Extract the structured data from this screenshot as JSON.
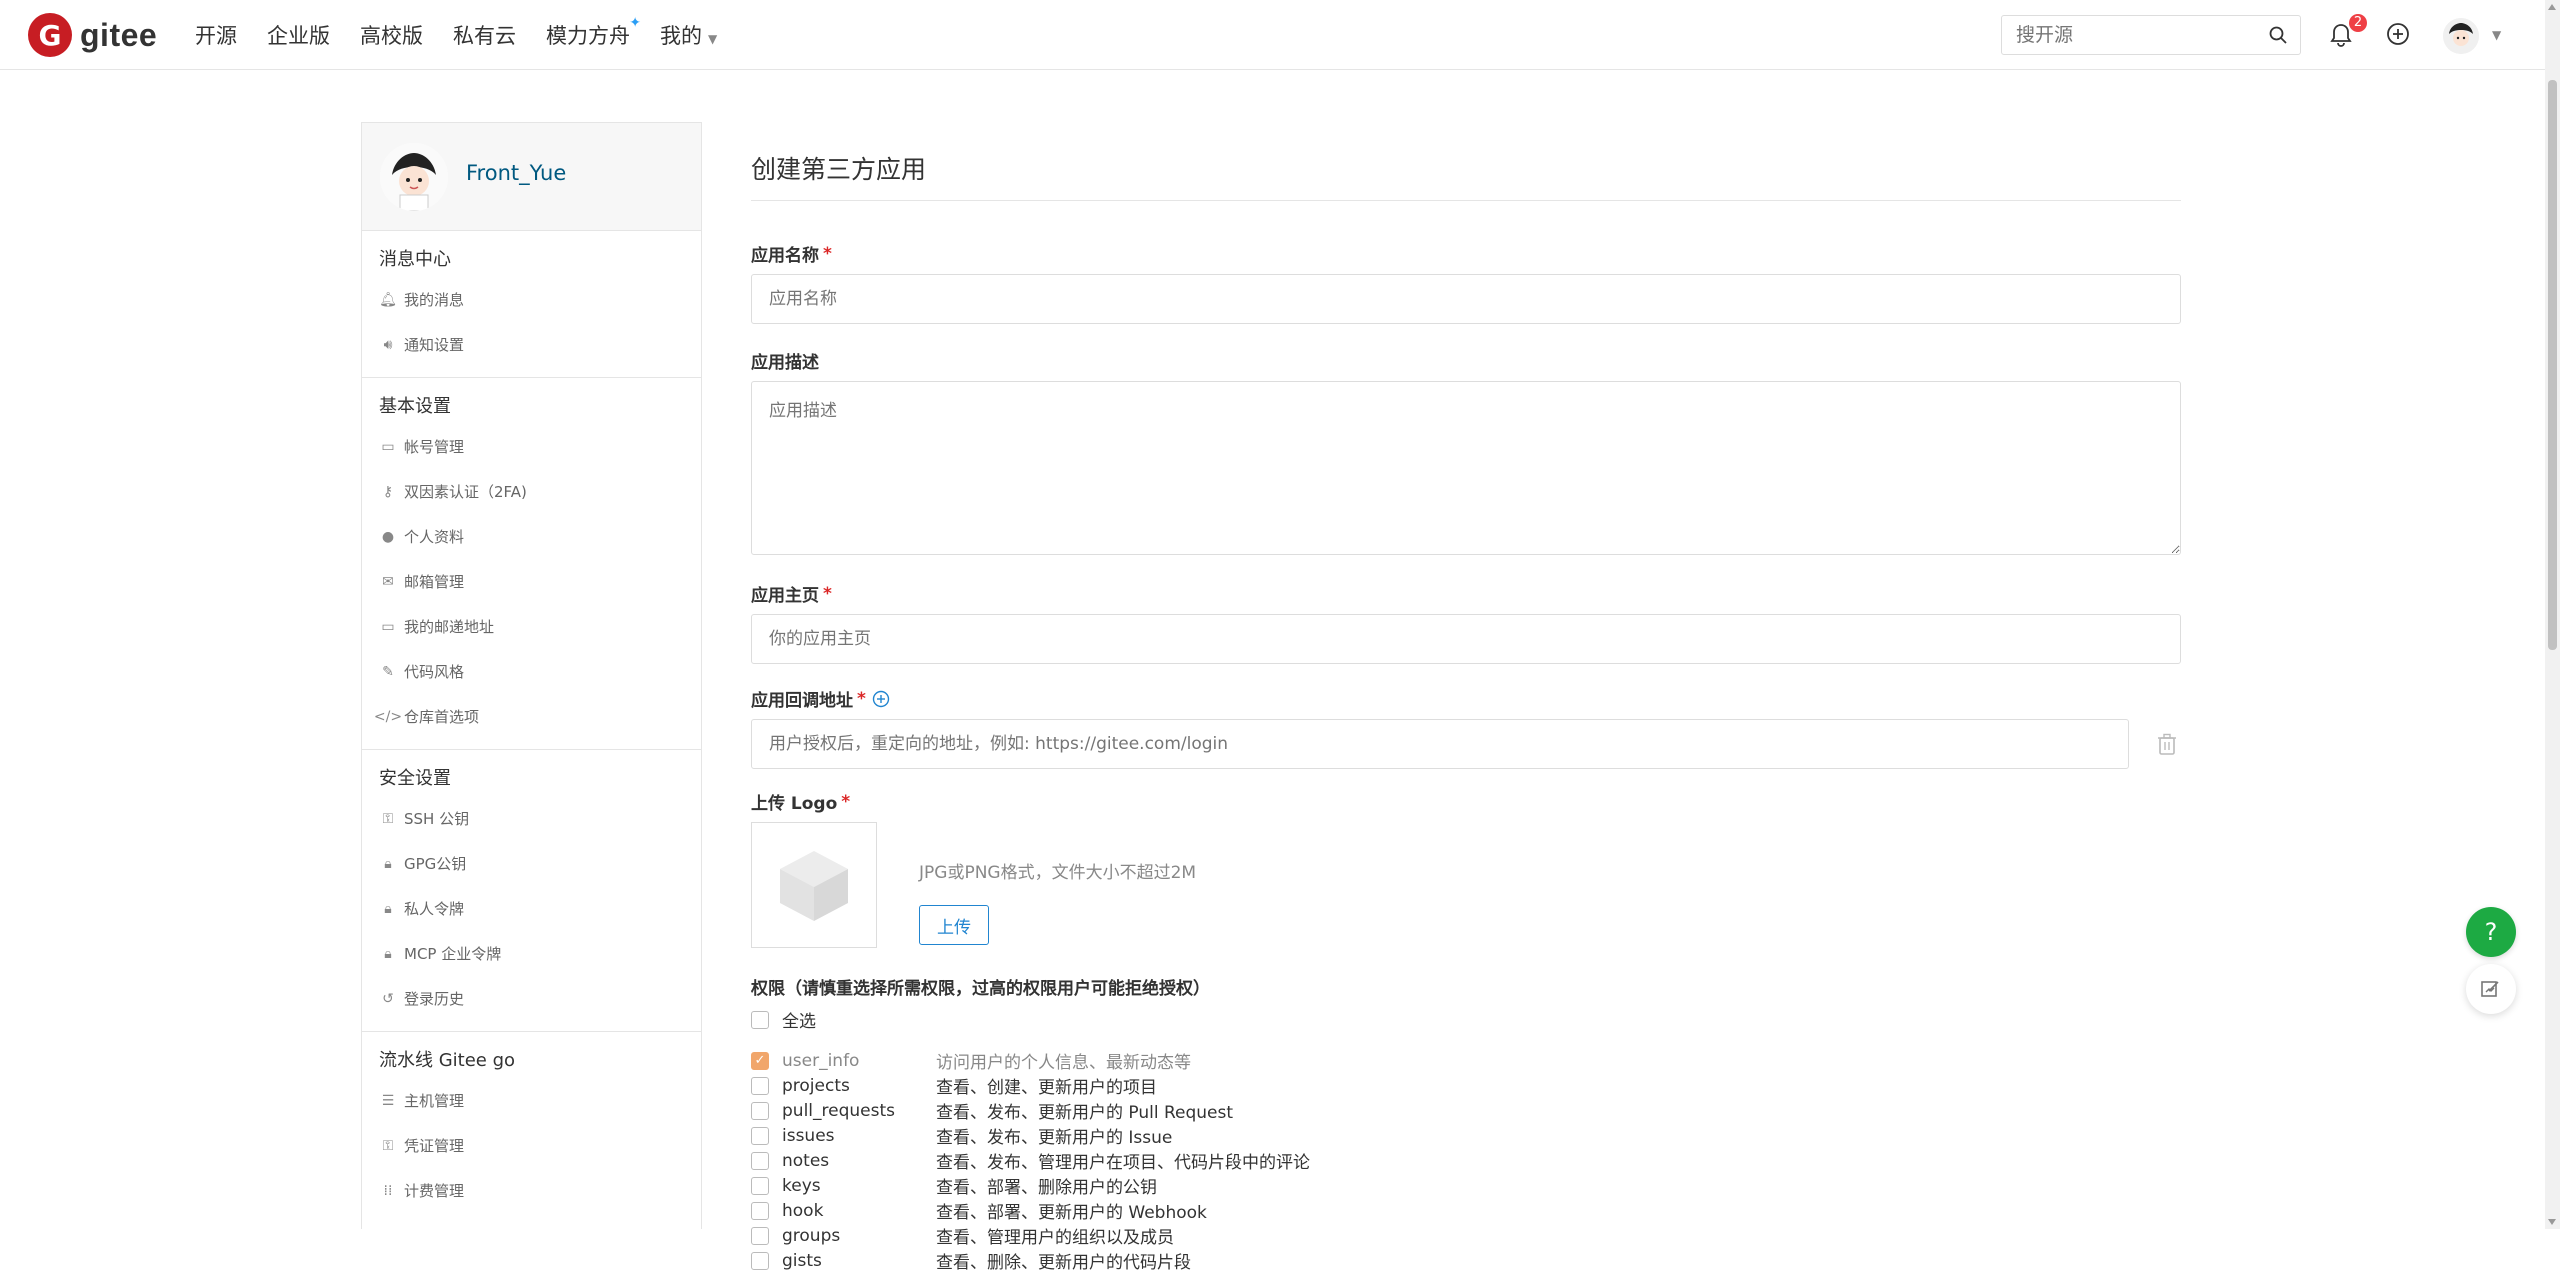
{
  "nav": {
    "logo_text": "gitee",
    "items": [
      "开源",
      "企业版",
      "高校版",
      "私有云",
      "模力方舟",
      "我的"
    ],
    "search_placeholder": "搜开源",
    "notifications_count": "2"
  },
  "sidebar": {
    "username": "Front_Yue",
    "sections": [
      {
        "title": "消息中心",
        "items": [
          {
            "icon": "bell-icon",
            "label": "我的消息"
          },
          {
            "icon": "speaker-icon",
            "label": "通知设置"
          }
        ]
      },
      {
        "title": "基本设置",
        "items": [
          {
            "icon": "id-card-icon",
            "label": "帐号管理"
          },
          {
            "icon": "user-key-icon",
            "label": "双因素认证（2FA)"
          },
          {
            "icon": "user-icon",
            "label": "个人资料"
          },
          {
            "icon": "mail-icon",
            "label": "邮箱管理"
          },
          {
            "icon": "address-card-icon",
            "label": "我的邮递地址"
          },
          {
            "icon": "paint-brush-icon",
            "label": "代码风格"
          },
          {
            "icon": "code-icon",
            "label": "仓库首选项"
          }
        ]
      },
      {
        "title": "安全设置",
        "items": [
          {
            "icon": "key-icon",
            "label": "SSH 公钥"
          },
          {
            "icon": "lock-icon",
            "label": "GPG公钥"
          },
          {
            "icon": "lock-token-icon",
            "label": "私人令牌"
          },
          {
            "icon": "lock-token-icon",
            "label": "MCP 企业令牌"
          },
          {
            "icon": "history-icon",
            "label": "登录历史"
          }
        ]
      },
      {
        "title": "流水线 Gitee go",
        "items": [
          {
            "icon": "list-icon",
            "label": "主机管理"
          },
          {
            "icon": "key-icon",
            "label": "凭证管理"
          },
          {
            "icon": "grid-icon",
            "label": "计费管理"
          }
        ]
      }
    ]
  },
  "form": {
    "title": "创建第三方应用",
    "app_name_label": "应用名称",
    "app_name_placeholder": "应用名称",
    "app_desc_label": "应用描述",
    "app_desc_placeholder": "应用描述",
    "homepage_label": "应用主页",
    "homepage_placeholder": "你的应用主页",
    "callback_label": "应用回调地址",
    "callback_placeholder": "用户授权后，重定向的地址，例如: https://gitee.com/login",
    "logo_label": "上传 Logo",
    "logo_hint": "JPG或PNG格式，文件大小不超过2M",
    "upload_button": "上传",
    "perm_title": "权限（请慎重选择所需权限，过高的权限用户可能拒绝授权）",
    "select_all": "全选",
    "permissions": [
      {
        "name": "user_info",
        "desc": "访问用户的个人信息、最新动态等",
        "checked": true
      },
      {
        "name": "projects",
        "desc": "查看、创建、更新用户的项目",
        "checked": false
      },
      {
        "name": "pull_requests",
        "desc": "查看、发布、更新用户的 Pull Request",
        "checked": false
      },
      {
        "name": "issues",
        "desc": "查看、发布、更新用户的 Issue",
        "checked": false
      },
      {
        "name": "notes",
        "desc": "查看、发布、管理用户在项目、代码片段中的评论",
        "checked": false
      },
      {
        "name": "keys",
        "desc": "查看、部署、删除用户的公钥",
        "checked": false
      },
      {
        "name": "hook",
        "desc": "查看、部署、更新用户的 Webhook",
        "checked": false
      },
      {
        "name": "groups",
        "desc": "查看、管理用户的组织以及成员",
        "checked": false
      },
      {
        "name": "gists",
        "desc": "查看、删除、更新用户的代码片段",
        "checked": false
      }
    ]
  },
  "floating": {
    "help_label": "?"
  },
  "colors": {
    "brand": "#c71d23",
    "link": "#005980",
    "primary": "#2185d0",
    "help": "#1daa43"
  }
}
